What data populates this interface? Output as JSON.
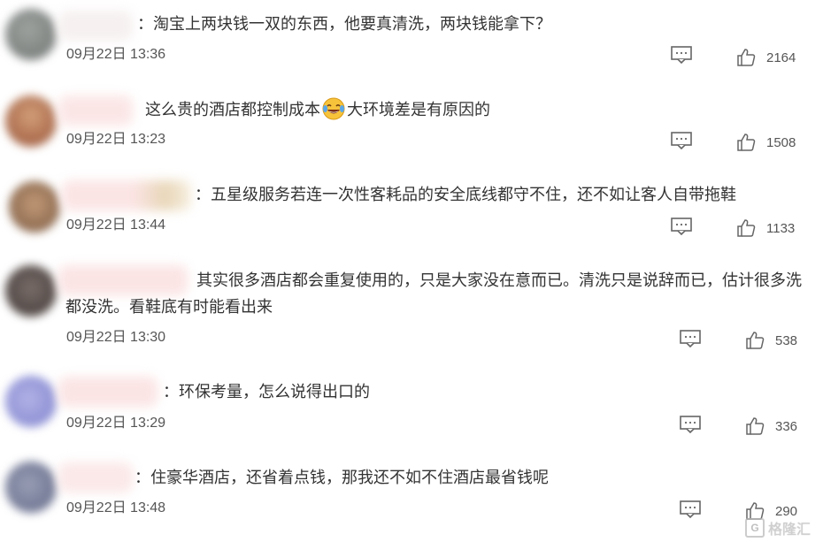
{
  "comments": [
    {
      "text": "：淘宝上两块钱一双的东西，他要真清洗，两块钱能拿下？",
      "time": "09月22日 13:36",
      "likes": "2164"
    },
    {
      "text_before": "这么贵的酒店都控制成本",
      "emoji": "laughing-tears-emoji",
      "text_after": "大环境差是有原因的",
      "time": "09月22日 13:23",
      "likes": "1508"
    },
    {
      "text": "：五星级服务若连一次性客耗品的安全底线都守不住，还不如让客人自带拖鞋",
      "time": "09月22日 13:44",
      "likes": "1133"
    },
    {
      "text": "其实很多酒店都会重复使用的，只是大家没在意而已。清洗只是说辞而已，估计很多洗都没洗。看鞋底有时能看出来",
      "time": "09月22日 13:30",
      "likes": "538"
    },
    {
      "text": "：环保考量，怎么说得出口的",
      "time": "09月22日 13:29",
      "likes": "336"
    },
    {
      "text": "：住豪华酒店，还省着点钱，那我还不如不住酒店最省钱呢",
      "time": "09月22日 13:48",
      "likes": "290"
    }
  ],
  "watermark": {
    "logo": "G",
    "text": "格隆汇"
  },
  "colors": {
    "text": "#333333",
    "meta": "#555555",
    "icon": "#666666"
  }
}
